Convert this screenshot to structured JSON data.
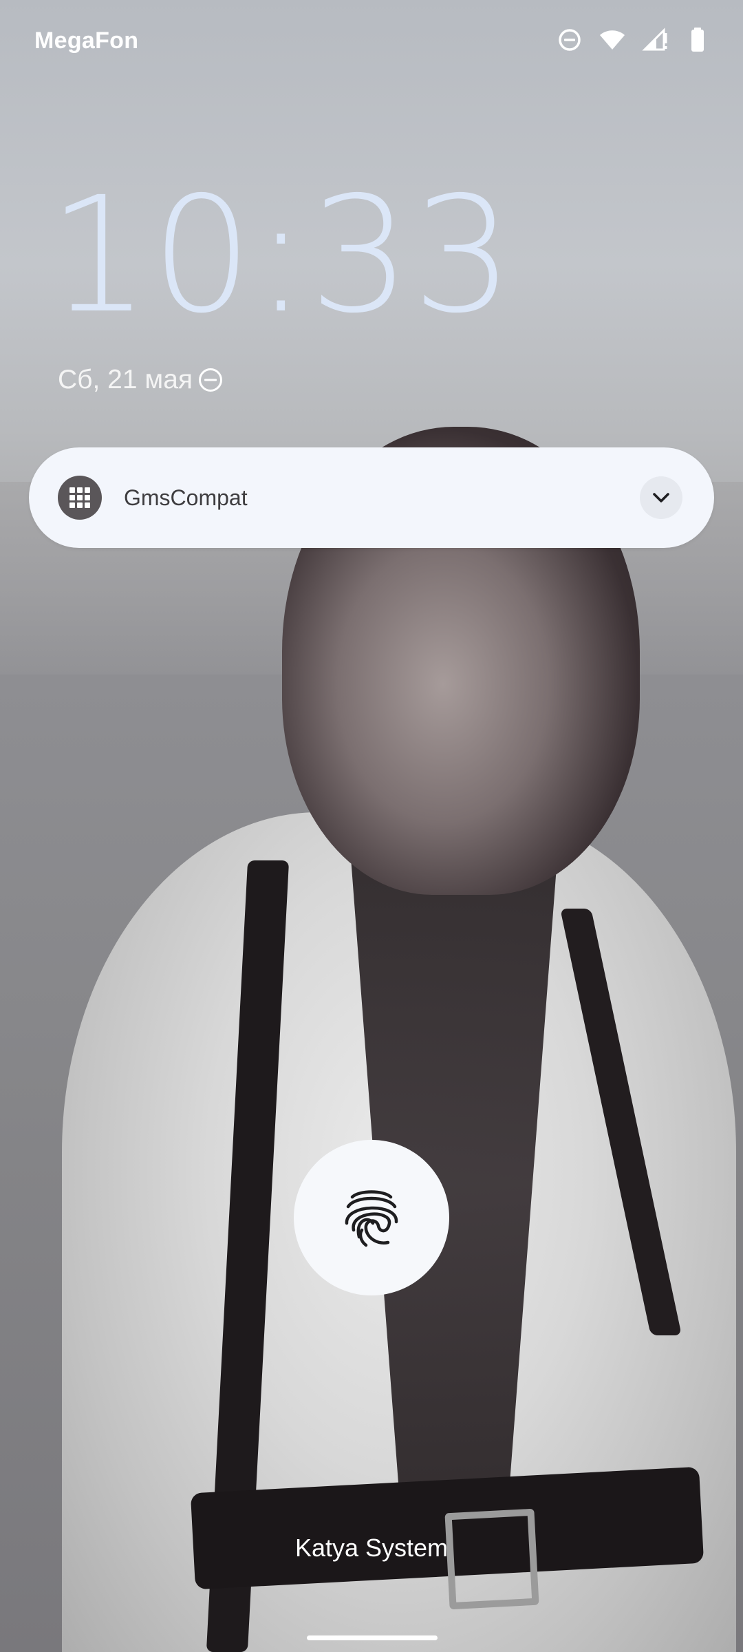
{
  "status_bar": {
    "carrier": "MegaFon",
    "icons": [
      "do-not-disturb-icon",
      "wifi-icon",
      "cellular-signal-icon",
      "battery-icon"
    ]
  },
  "lockscreen": {
    "time": "10:33",
    "date": "Сб, 21 мая",
    "date_icon": "do-not-disturb-icon"
  },
  "notification": {
    "app_name": "GmsCompat",
    "app_icon": "grid-icon",
    "expand_icon": "chevron-down-icon"
  },
  "unlock": {
    "icon": "fingerprint-icon"
  },
  "owner_info": "Katya System",
  "colors": {
    "clock": "#dbe6f7",
    "card_bg": "#f3f6fc",
    "fingerprint_bg": "#f6f8fb"
  }
}
